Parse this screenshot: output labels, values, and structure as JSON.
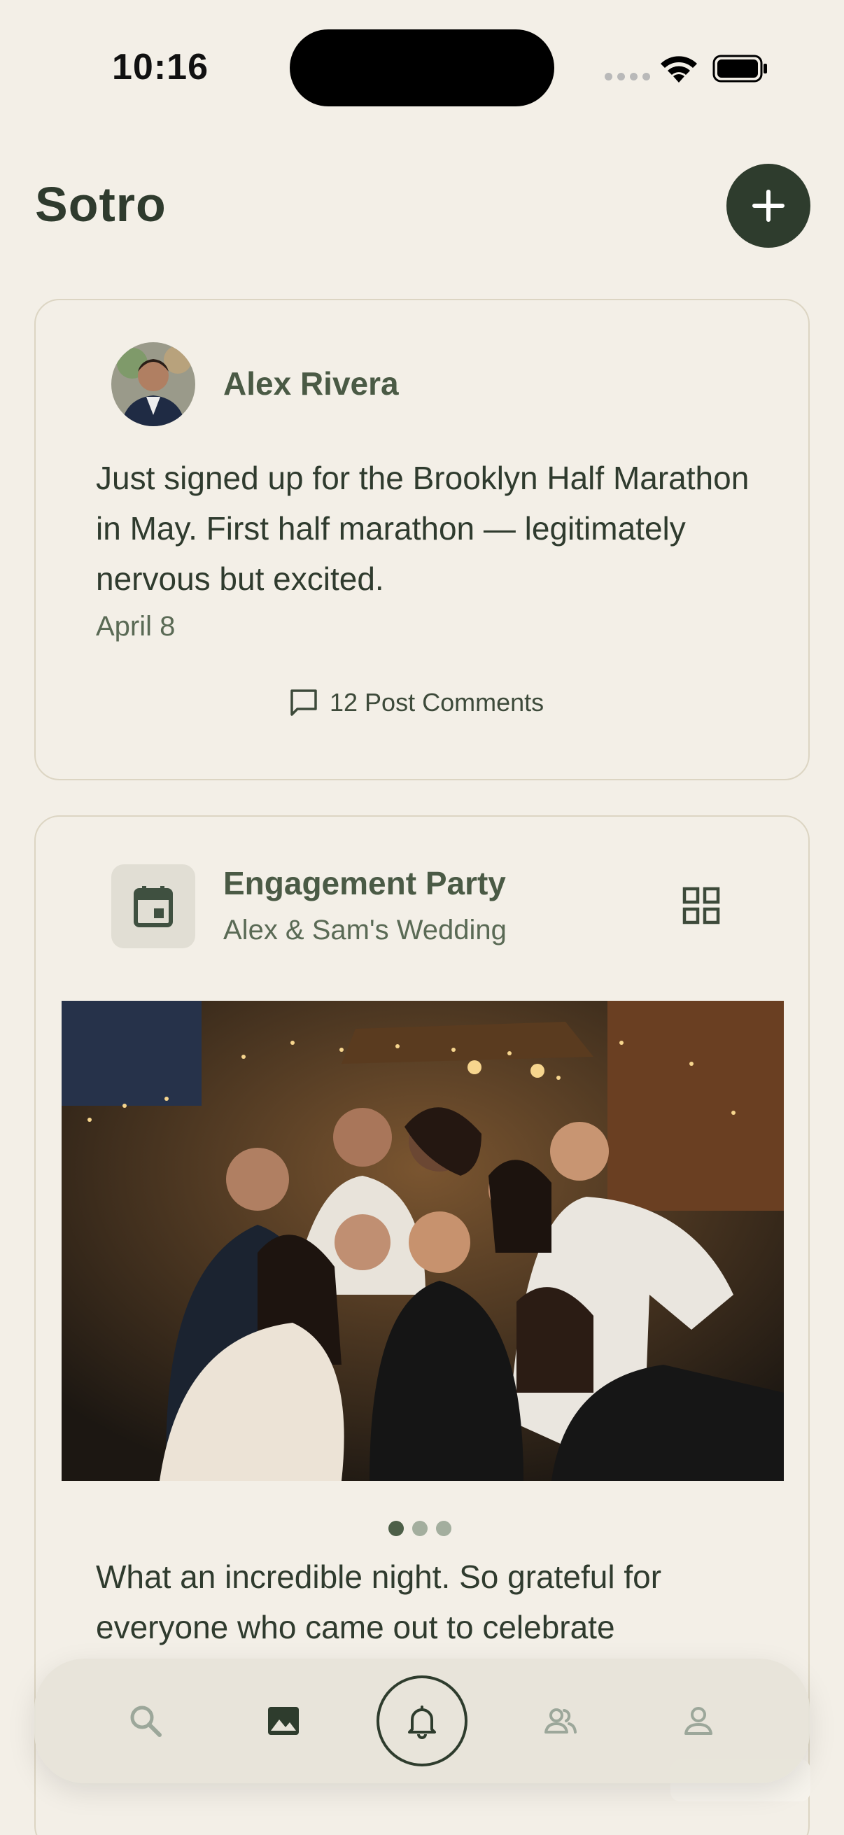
{
  "status_bar": {
    "time": "10:16"
  },
  "header": {
    "title": "Sotro",
    "add_label": "+"
  },
  "posts": [
    {
      "author": "Alex Rivera",
      "text": "Just signed up for the Brooklyn Half Marathon in May. First half marathon — legitimately nervous but excited.",
      "date": "April 8",
      "comments_label": "12 Post Comments"
    },
    {
      "event_title": "Engagement Party",
      "event_subtitle": "Alex & Sam's Wedding",
      "photo_count": 3,
      "active_photo": 1,
      "caption": "What an incredible night. So grateful for everyone who came out to celebrate"
    }
  ],
  "bottom_nav": {
    "items": [
      {
        "icon": "search-icon",
        "active": false
      },
      {
        "icon": "image-icon",
        "active": true
      },
      {
        "icon": "bell-icon",
        "active": false
      },
      {
        "icon": "people-icon",
        "active": false
      },
      {
        "icon": "person-icon",
        "active": false
      }
    ]
  },
  "colors": {
    "background": "#f3efe7",
    "accent": "#2e3c2d",
    "text": "#2f3b2e",
    "muted": "#5a6a55"
  }
}
